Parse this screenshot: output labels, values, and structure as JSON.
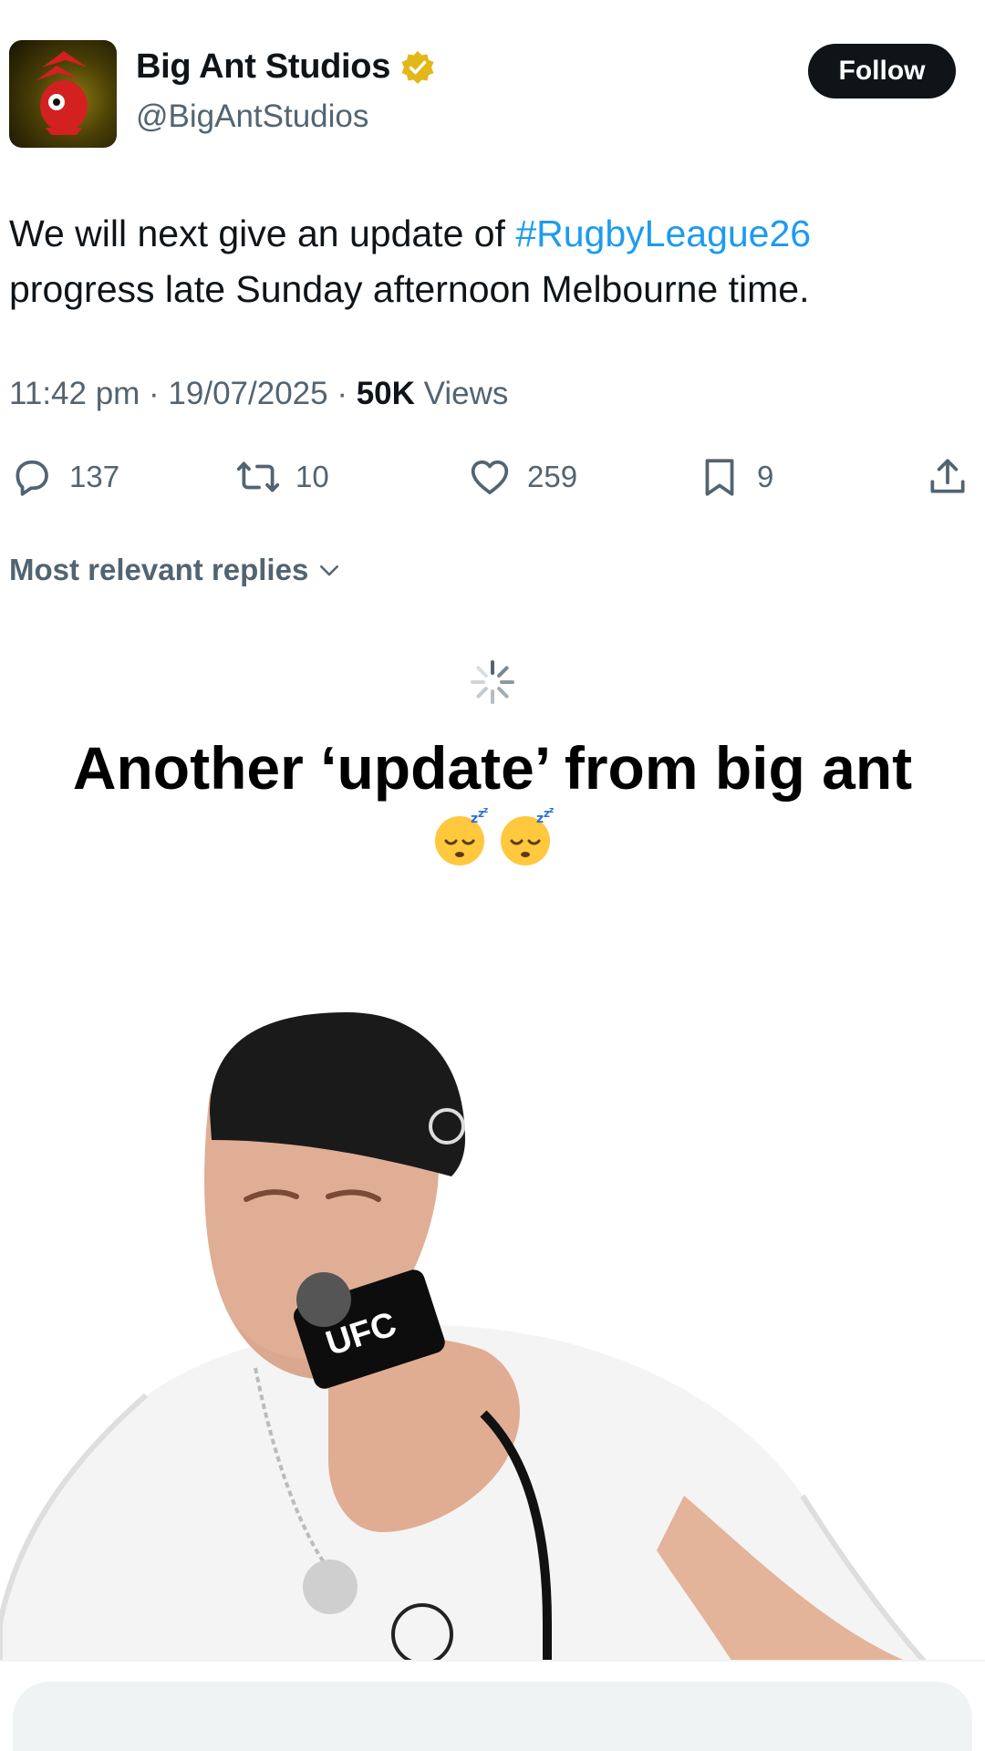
{
  "tweet": {
    "author": {
      "display_name": "Big Ant Studios",
      "handle": "@BigAntStudios",
      "verified_badge": "verified-gold-icon"
    },
    "follow_label": "Follow",
    "text_before": "We will next give an update of ",
    "hashtag": "#RugbyLeague26",
    "text_after": " progress late Sunday afternoon Melbourne time.",
    "meta_prefix": "11:42 pm · 19/07/2025 · ",
    "views_count": "50K",
    "views_label": " Views",
    "actions": {
      "replies": "137",
      "reposts": "10",
      "likes": "259",
      "bookmarks": "9"
    }
  },
  "replies_sort": {
    "label": "Most relevant replies"
  },
  "overlay": {
    "caption": "Another ‘update’ from big ant",
    "emoji": [
      "sleeping-face",
      "sleeping-face"
    ]
  },
  "photo": {
    "mic_label": "UFC"
  },
  "colors": {
    "text": "#0f1419",
    "secondary": "#536471",
    "link": "#1d9bf0",
    "verified_gold": "#e2b719",
    "follow_bg": "#0f1419"
  }
}
